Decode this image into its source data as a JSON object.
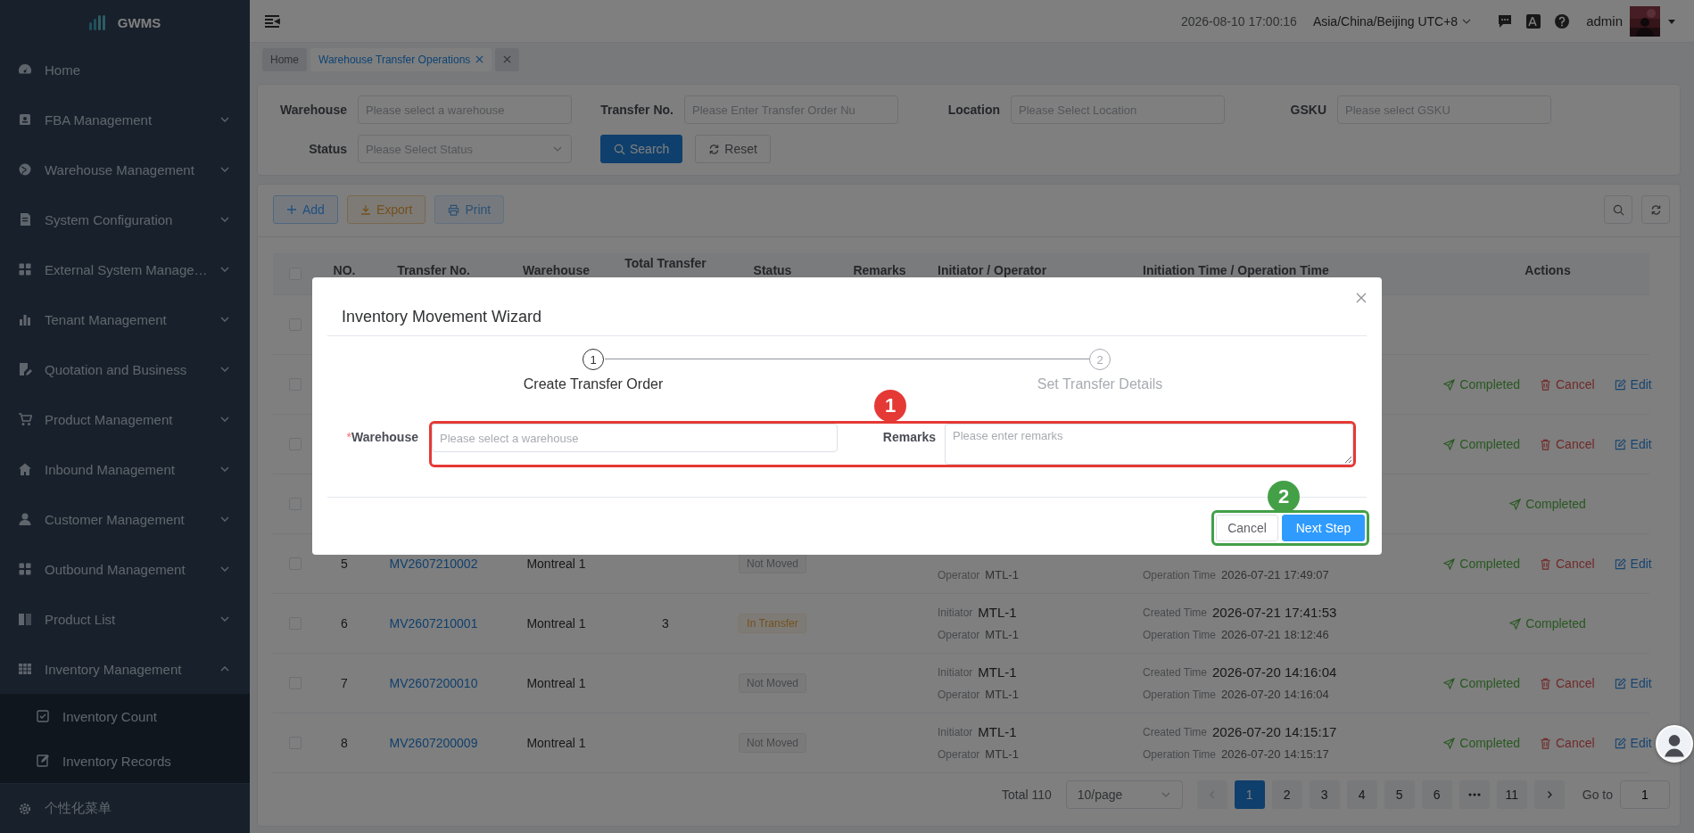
{
  "sidebar": {
    "logo": "GWMS",
    "items": [
      {
        "label": "Home"
      },
      {
        "label": "FBA Management",
        "expanded": false
      },
      {
        "label": "Warehouse Management",
        "expanded": false
      },
      {
        "label": "System Configuration",
        "expanded": false
      },
      {
        "label": "External System Manage…",
        "expanded": false
      },
      {
        "label": "Tenant Management",
        "expanded": false
      },
      {
        "label": "Quotation and Business",
        "expanded": false
      },
      {
        "label": "Product Management",
        "expanded": false
      },
      {
        "label": "Inbound Management",
        "expanded": false
      },
      {
        "label": "Customer Management",
        "expanded": false
      },
      {
        "label": "Outbound Management",
        "expanded": false
      },
      {
        "label": "Product List",
        "expanded": false
      },
      {
        "label": "Inventory Management",
        "expanded": true,
        "children": [
          {
            "label": "Inventory Count"
          },
          {
            "label": "Inventory Records"
          }
        ]
      }
    ],
    "footer": "个性化菜单"
  },
  "topbar": {
    "datetime": "2026-08-10 17:00:16",
    "timezone": "Asia/China/Beijing UTC+8",
    "user": "admin"
  },
  "tabs": [
    {
      "label": "Home",
      "selected": false,
      "closable": false
    },
    {
      "label": "Warehouse Transfer Operations",
      "selected": true,
      "closable": true
    }
  ],
  "filters": [
    {
      "label": "Warehouse",
      "placeholder": "Please select a warehouse",
      "kind": "input"
    },
    {
      "label": "Transfer No.",
      "placeholder": "Please Enter Transfer Order Nu",
      "kind": "input"
    },
    {
      "label": "Location",
      "placeholder": "Please Select Location",
      "kind": "input"
    },
    {
      "label": "GSKU",
      "placeholder": "Please select GSKU",
      "kind": "input"
    },
    {
      "label": "Status",
      "placeholder": "Please Select Status",
      "kind": "select"
    }
  ],
  "filter_buttons": [
    {
      "label": "Search",
      "kind": "search"
    },
    {
      "label": "Reset",
      "kind": "reset"
    }
  ],
  "toolbar": [
    {
      "label": "Add",
      "kind": "add",
      "disabled": false
    },
    {
      "label": "Export",
      "kind": "export",
      "disabled": false
    },
    {
      "label": "Print",
      "kind": "print",
      "disabled": true
    }
  ],
  "table": {
    "all_checked": false,
    "columns": [
      "NO.",
      "Transfer No.",
      "Warehouse",
      "Total Transfer",
      "Status",
      "Remarks",
      "Initiator / Operator",
      "Initiation Time / Operation Time",
      "Actions"
    ],
    "rows": [
      {
        "checked": false
      },
      {
        "checked": false,
        "actions": [
          {
            "label": "Completed",
            "kind": "complete"
          },
          {
            "label": "Cancel",
            "kind": "cancel"
          },
          {
            "label": "Edit",
            "kind": "edit"
          }
        ]
      },
      {
        "checked": false,
        "actions": [
          {
            "label": "Completed",
            "kind": "complete"
          },
          {
            "label": "Cancel",
            "kind": "cancel"
          },
          {
            "label": "Edit",
            "kind": "edit"
          }
        ]
      },
      {
        "checked": false,
        "actions": [
          {
            "label": "Completed",
            "kind": "complete"
          }
        ]
      },
      {
        "checked": false,
        "no": "5",
        "transfer_no": "MV2607210002",
        "warehouse": "Montreal 1",
        "status": {
          "label": "Not Moved",
          "kind": "info"
        },
        "people": [
          {
            "label": "Operator",
            "value": "MTL-1"
          }
        ],
        "times": [
          {
            "label": "Operation Time",
            "value": "2026-07-21 17:49:07"
          }
        ],
        "actions": [
          {
            "label": "Completed",
            "kind": "complete"
          },
          {
            "label": "Cancel",
            "kind": "cancel"
          },
          {
            "label": "Edit",
            "kind": "edit"
          }
        ]
      },
      {
        "checked": false,
        "no": "6",
        "transfer_no": "MV2607210001",
        "warehouse": "Montreal 1",
        "total": "3",
        "status": {
          "label": "In Transfer",
          "kind": "warning"
        },
        "people": [
          {
            "label": "Initiator",
            "value": "MTL-1"
          },
          {
            "label": "Operator",
            "value": "MTL-1"
          }
        ],
        "times": [
          {
            "label": "Created Time",
            "value": "2026-07-21 17:41:53"
          },
          {
            "label": "Operation Time",
            "value": "2026-07-21 18:12:46"
          }
        ],
        "actions": [
          {
            "label": "Completed",
            "kind": "complete"
          }
        ]
      },
      {
        "checked": false,
        "no": "7",
        "transfer_no": "MV2607200010",
        "warehouse": "Montreal 1",
        "status": {
          "label": "Not Moved",
          "kind": "info"
        },
        "people": [
          {
            "label": "Initiator",
            "value": "MTL-1"
          },
          {
            "label": "Operator",
            "value": "MTL-1"
          }
        ],
        "times": [
          {
            "label": "Created Time",
            "value": "2026-07-20 14:16:04"
          },
          {
            "label": "Operation Time",
            "value": "2026-07-20 14:16:04"
          }
        ],
        "actions": [
          {
            "label": "Completed",
            "kind": "complete"
          },
          {
            "label": "Cancel",
            "kind": "cancel"
          },
          {
            "label": "Edit",
            "kind": "edit"
          }
        ]
      },
      {
        "checked": false,
        "no": "8",
        "transfer_no": "MV2607200009",
        "warehouse": "Montreal 1",
        "status": {
          "label": "Not Moved",
          "kind": "info"
        },
        "people": [
          {
            "label": "Initiator",
            "value": "MTL-1"
          },
          {
            "label": "Operator",
            "value": "MTL-1"
          }
        ],
        "times": [
          {
            "label": "Created Time",
            "value": "2026-07-20 14:15:17"
          },
          {
            "label": "Operation Time",
            "value": "2026-07-20 14:15:17"
          }
        ],
        "actions": [
          {
            "label": "Completed",
            "kind": "complete"
          },
          {
            "label": "Cancel",
            "kind": "cancel"
          },
          {
            "label": "Edit",
            "kind": "edit"
          }
        ]
      }
    ]
  },
  "pagination": {
    "total": "Total 110",
    "page_size": "10/page",
    "pages": [
      {
        "kind": "page",
        "label": "1",
        "selected": true
      },
      {
        "kind": "page",
        "label": "2",
        "selected": false
      },
      {
        "kind": "page",
        "label": "3",
        "selected": false
      },
      {
        "kind": "page",
        "label": "4",
        "selected": false
      },
      {
        "kind": "page",
        "label": "5",
        "selected": false
      },
      {
        "kind": "page",
        "label": "6",
        "selected": false
      },
      {
        "kind": "more"
      },
      {
        "kind": "page",
        "label": "11",
        "selected": false
      }
    ],
    "goto_label": "Go to",
    "goto_value": "1"
  },
  "modal": {
    "title": "Inventory Movement Wizard",
    "steps": [
      {
        "number": "1",
        "label": "Create Transfer Order",
        "active": true
      },
      {
        "number": "2",
        "label": "Set Transfer Details",
        "active": false
      }
    ],
    "form": [
      {
        "mark": "*",
        "label": "Warehouse",
        "placeholder": "Please select a warehouse",
        "kind": "input"
      },
      {
        "label": "Remarks",
        "placeholder": "Please enter remarks",
        "kind": "textarea"
      }
    ],
    "buttons": [
      {
        "label": "Cancel",
        "kind": "default"
      },
      {
        "label": "Next Step",
        "kind": "primary"
      }
    ],
    "annotations": [
      {
        "label": "1",
        "color": "#e53935"
      },
      {
        "label": "2",
        "color": "#43a047"
      }
    ]
  }
}
